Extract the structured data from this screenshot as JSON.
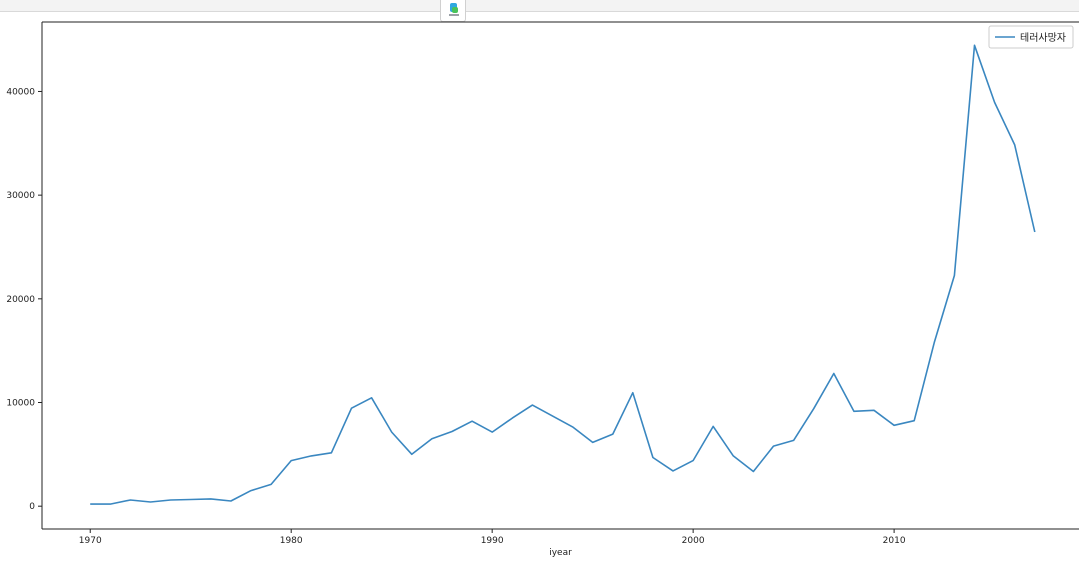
{
  "chart_data": {
    "type": "line",
    "xlabel": "iyear",
    "ylabel": "",
    "xlim": [
      1967.65,
      1019.0
    ],
    "ylim": [
      -2200,
      46700
    ],
    "xticks": [
      1970,
      1980,
      1990,
      2000,
      2010
    ],
    "yticks": [
      0,
      10000,
      20000,
      30000,
      40000
    ],
    "legend_position": "top-right",
    "grid": false,
    "series": [
      {
        "name": "테러사망자",
        "color": "#3a87c0",
        "x": [
          1970,
          1971,
          1972,
          1973,
          1974,
          1975,
          1976,
          1977,
          1978,
          1979,
          1980,
          1981,
          1982,
          1983,
          1984,
          1985,
          1986,
          1987,
          1988,
          1989,
          1990,
          1991,
          1992,
          1994,
          1995,
          1996,
          1997,
          1998,
          1999,
          2000,
          2001,
          2002,
          2003,
          2004,
          2005,
          2006,
          2007,
          2008,
          2009,
          2010,
          2011,
          2012,
          2013,
          2014,
          2015,
          2016,
          2017
        ],
        "values": [
          200,
          200,
          600,
          400,
          600,
          650,
          700,
          500,
          1500,
          2100,
          4400,
          4850,
          5150,
          9450,
          10450,
          7150,
          5000,
          6500,
          7200,
          8200,
          7150,
          8500,
          9750,
          7650,
          6150,
          6950,
          10950,
          4700,
          3400,
          4400,
          7700,
          4850,
          3350,
          5800,
          6350,
          9400,
          12800,
          9150,
          9250,
          7800,
          8250,
          15800,
          22250,
          44450,
          38950,
          34850,
          26450
        ]
      }
    ]
  },
  "app_icon": "app-launcher-icon"
}
